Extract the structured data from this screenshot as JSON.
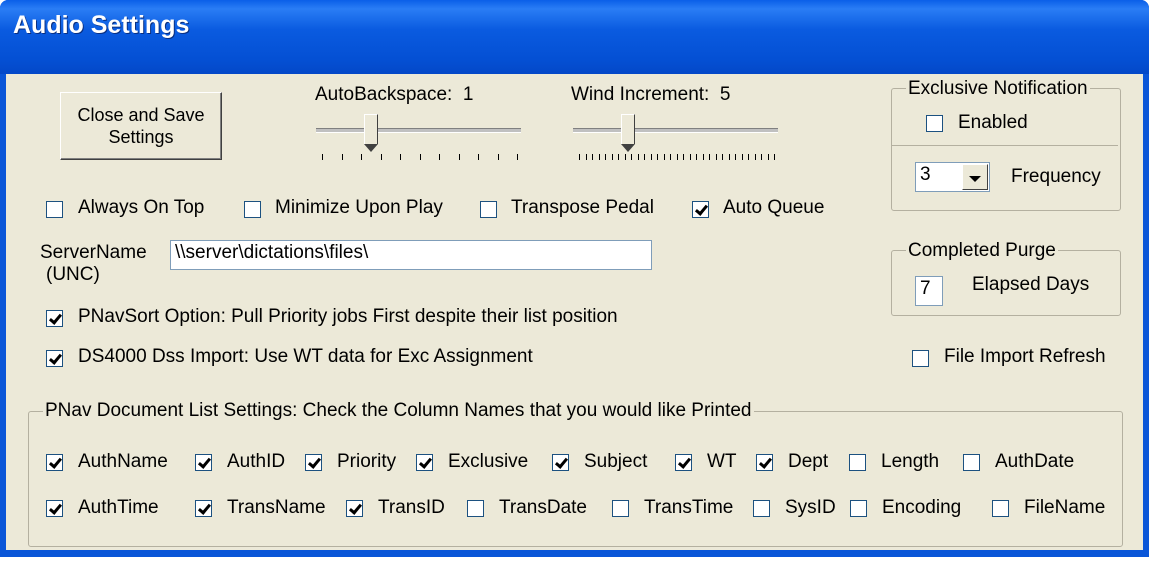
{
  "window": {
    "title": "Audio Settings"
  },
  "buttons": {
    "close_save": "Close and Save Settings"
  },
  "sliders": {
    "autobackspace": {
      "label": "AutoBackspace:",
      "value": "1"
    },
    "wind_increment": {
      "label": "Wind Increment:",
      "value": "5"
    }
  },
  "options": {
    "always_on_top": {
      "label": "Always On Top",
      "checked": false
    },
    "minimize_upon_play": {
      "label": "Minimize Upon Play",
      "checked": false
    },
    "transpose_pedal": {
      "label": "Transpose Pedal",
      "checked": false
    },
    "auto_queue": {
      "label": "Auto Queue",
      "checked": true
    }
  },
  "server": {
    "label_line1": "ServerName",
    "label_line2": "(UNC)",
    "value": "\\\\server\\dictations\\files\\"
  },
  "pnavsort": {
    "label": "PNavSort Option: Pull Priority jobs First despite their list position",
    "checked": true
  },
  "ds4000": {
    "label": "DS4000 Dss Import: Use WT data for Exc Assignment",
    "checked": true
  },
  "exclusive_notification": {
    "title": "Exclusive Notification",
    "enabled_label": "Enabled",
    "enabled": false,
    "frequency_value": "3",
    "frequency_label": "Frequency"
  },
  "completed_purge": {
    "title": "Completed Purge",
    "days_value": "7",
    "days_label": "Elapsed Days"
  },
  "file_import_refresh": {
    "label": "File Import Refresh",
    "checked": false
  },
  "doc_list": {
    "title": "PNav Document List Settings:  Check the Column Names that you would like Printed",
    "row1": [
      {
        "label": "AuthName",
        "checked": true
      },
      {
        "label": "AuthID",
        "checked": true
      },
      {
        "label": "Priority",
        "checked": true
      },
      {
        "label": "Exclusive",
        "checked": true
      },
      {
        "label": "Subject",
        "checked": true
      },
      {
        "label": "WT",
        "checked": true
      },
      {
        "label": "Dept",
        "checked": true
      },
      {
        "label": "Length",
        "checked": false
      },
      {
        "label": "AuthDate",
        "checked": false
      }
    ],
    "row2": [
      {
        "label": "AuthTime",
        "checked": true
      },
      {
        "label": "TransName",
        "checked": true
      },
      {
        "label": "TransID",
        "checked": true
      },
      {
        "label": "TransDate",
        "checked": false
      },
      {
        "label": "TransTime",
        "checked": false
      },
      {
        "label": "SysID",
        "checked": false
      },
      {
        "label": "Encoding",
        "checked": false
      },
      {
        "label": "FileName",
        "checked": false
      }
    ]
  }
}
